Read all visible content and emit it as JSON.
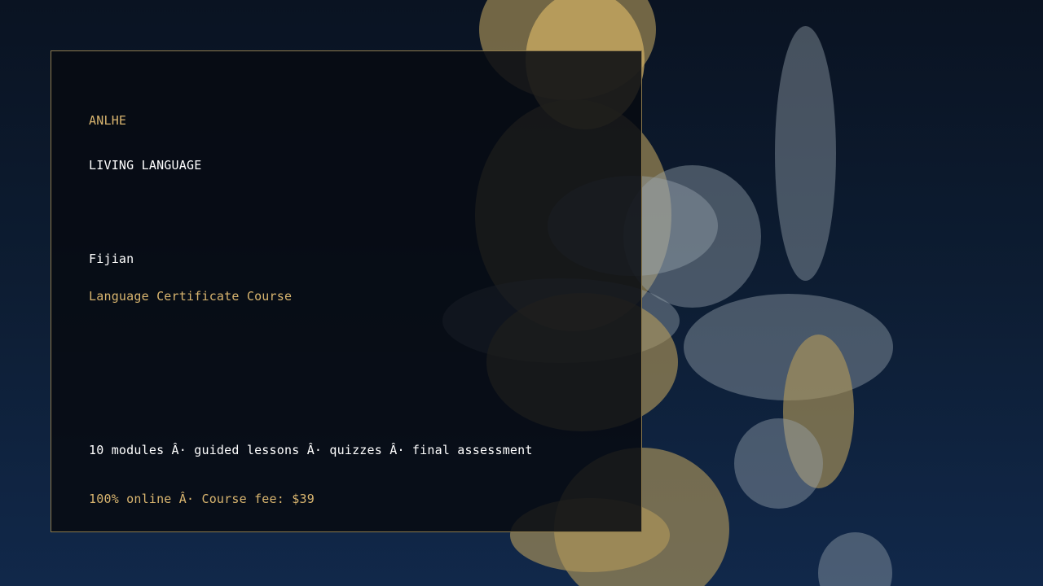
{
  "brand": "ANLHE",
  "tagline": "LIVING LANGUAGE",
  "course": {
    "language": "Fijian",
    "type": "Language Certificate Course"
  },
  "details": "10 modules Â· guided lessons Â· quizzes Â· final assessment",
  "pricing": "100% online Â· Course fee: $39",
  "colors": {
    "accent_gold": "#d9b56f",
    "card_border": "#8d7a4c",
    "background_top": "#0a1322",
    "background_bottom": "#11284a"
  }
}
